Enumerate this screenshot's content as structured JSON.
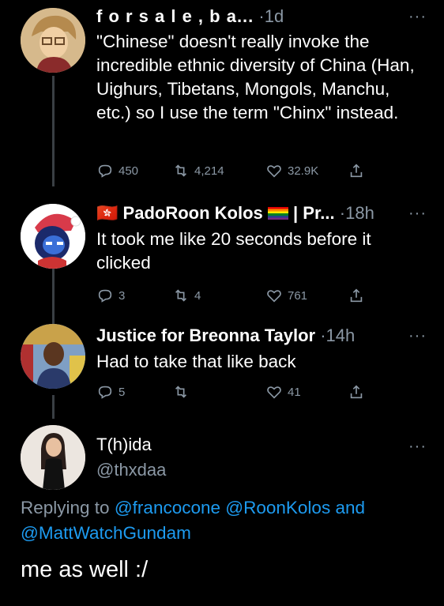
{
  "tweets": [
    {
      "name": "f o r   s a l e ,     b a...",
      "time": "·1d",
      "more": "···",
      "text": "\"Chinese\" doesn't really invoke the incredible ethnic diversity of China (Han, Uighurs, Tibetans, Mongols, Manchu, etc.) so I use the term \"Chinx\" instead.",
      "replies": "450",
      "retweets": "4,214",
      "likes": "32.9K"
    },
    {
      "flag": "🇭🇰",
      "name": "PadoRoon Kolos",
      "name_suffix": "| Pr...",
      "time": "·18h",
      "more": "···",
      "text": "It took me like 20 seconds before it clicked",
      "replies": "3",
      "retweets": "4",
      "likes": "761"
    },
    {
      "name": "Justice for Breonna Taylor",
      "time": "·14h",
      "more": "···",
      "text": "Had to take that like back",
      "replies": "5",
      "retweets": "",
      "likes": "41"
    }
  ],
  "main_tweet": {
    "name": "T(h)ida",
    "handle": "@thxdaa",
    "more": "···",
    "replying_prefix": "Replying to",
    "mentions": [
      "@francocone",
      "@RoonKolos",
      "and",
      "@MattWatchGundam"
    ],
    "text": "me as well :/"
  },
  "colors": {
    "background": "#000000",
    "muted": "#8b98a5",
    "link": "#1d9bf0"
  }
}
